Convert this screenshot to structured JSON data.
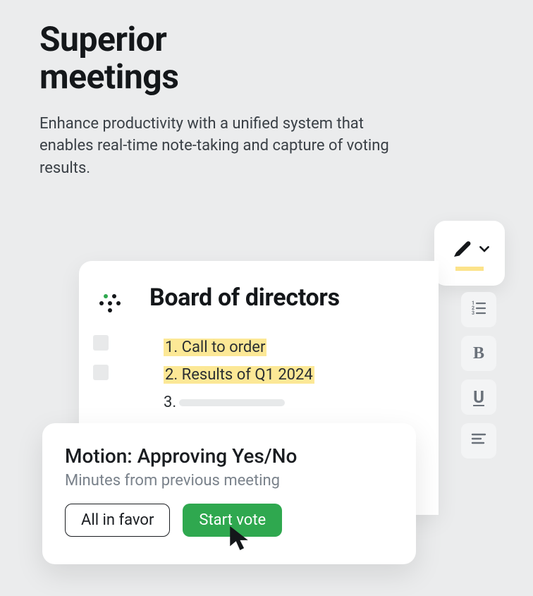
{
  "hero": {
    "title_line1": "Superior",
    "title_line2": "meetings",
    "subtitle": "Enhance productivity with a unified system that enables real-time note-taking and capture of voting results."
  },
  "doc": {
    "title": "Board of directors",
    "agenda": [
      {
        "num": "1.",
        "text": "Call to order",
        "highlighted": true
      },
      {
        "num": "2.",
        "text": "Results of Q1 2024",
        "highlighted": true
      },
      {
        "num": "3.",
        "text": "",
        "highlighted": false
      }
    ]
  },
  "motion": {
    "title": "Motion: Approving Yes/No",
    "subtitle": "Minutes from previous meeting",
    "all_in_favor_label": "All in favor",
    "start_vote_label": "Start vote"
  },
  "toolbar": {
    "highlighter_icon": "highlighter",
    "buttons": [
      "numbered-list",
      "bold",
      "underline",
      "align-left"
    ]
  },
  "colors": {
    "highlight": "#fce896",
    "primary_green": "#2fa84f"
  }
}
